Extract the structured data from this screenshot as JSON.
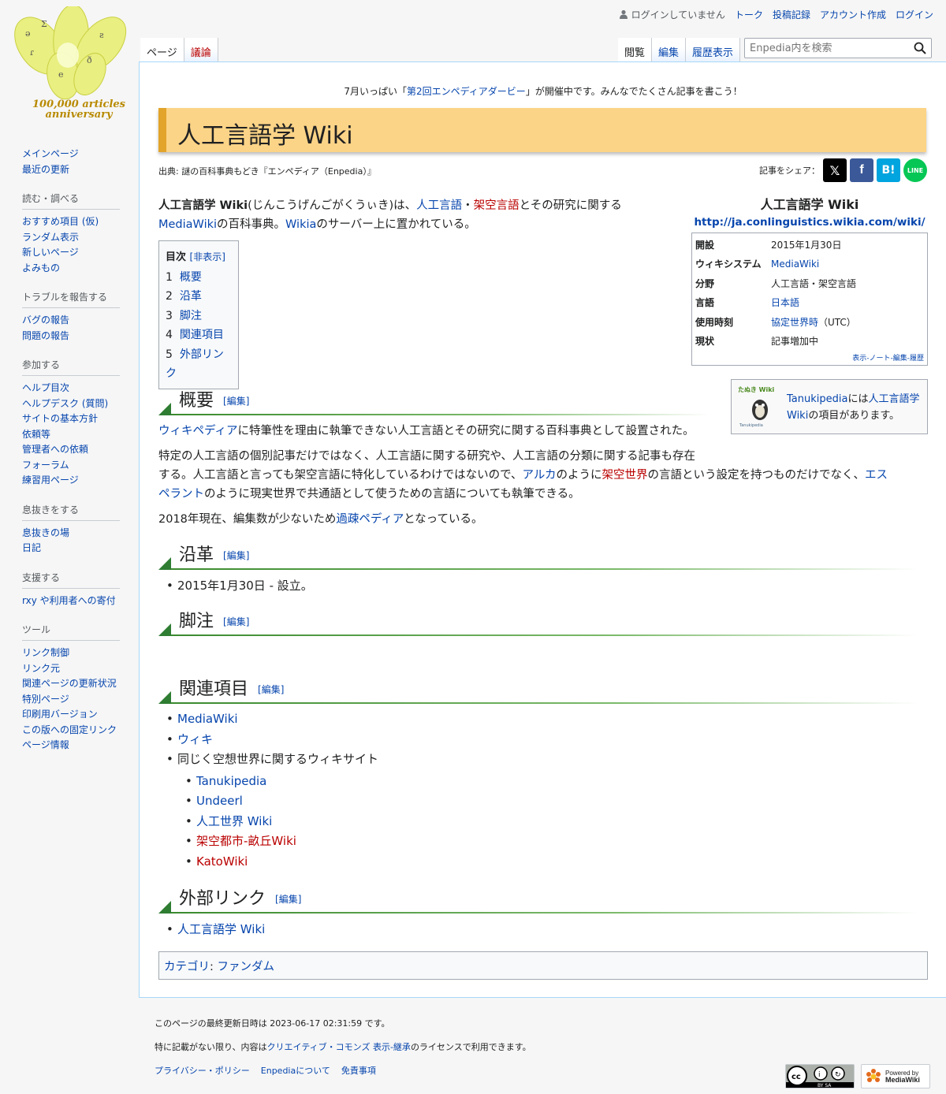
{
  "logo": {
    "text_line1": "100,000 articles",
    "text_line2": "anniversary"
  },
  "personal": {
    "status": "ログインしていません",
    "links": [
      "トーク",
      "投稿記録",
      "アカウント作成",
      "ログイン"
    ]
  },
  "tabs": {
    "left": [
      {
        "label": "ページ"
      },
      {
        "label": "議論"
      }
    ],
    "right": [
      {
        "label": "閲覧"
      },
      {
        "label": "編集"
      },
      {
        "label": "履歴表示"
      }
    ]
  },
  "search": {
    "placeholder": "Enpedia内を検索"
  },
  "sidebar": {
    "main": [
      "メインページ",
      "最近の更新"
    ],
    "groups": [
      {
        "heading": "読む・調べる",
        "items": [
          "おすすめ項目 (仮)",
          "ランダム表示",
          "新しいページ",
          "よみもの"
        ]
      },
      {
        "heading": "トラブルを報告する",
        "items": [
          "バグの報告",
          "問題の報告"
        ]
      },
      {
        "heading": "参加する",
        "items": [
          "ヘルプ目次",
          "ヘルプデスク (質問)",
          "サイトの基本方針",
          "依頼等",
          "管理者への依頼",
          "フォーラム",
          "練習用ページ"
        ]
      },
      {
        "heading": "息抜きをする",
        "items": [
          "息抜きの場",
          "日記"
        ]
      },
      {
        "heading": "支援する",
        "items": [
          "rxy や利用者への寄付"
        ]
      },
      {
        "heading": "ツール",
        "items": [
          "リンク制御",
          "リンク元",
          "関連ページの更新状況",
          "特別ページ",
          "印刷用バージョン",
          "この版への固定リンク",
          "ページ情報"
        ]
      }
    ]
  },
  "notice": {
    "before": "7月いっぱい「",
    "link": "第2回エンペディアダービー",
    "after": "」が開催中です。みんなでたくさん記事を書こう！"
  },
  "page": {
    "title": "人工言語学 Wiki",
    "source": "出典: 謎の百科事典もどき『エンペディア（Enpedia）』",
    "share_label": "記事をシェア："
  },
  "lead": {
    "bold": "人工言語学 Wiki",
    "t1": "(じんこうげんごがくうぃき)は、",
    "l1": "人工言語",
    "t2": "・",
    "l2": "架空言語",
    "t3": "とその研究に関する",
    "l3": "MediaWiki",
    "t4": "の百科事典。",
    "l4": "Wikia",
    "t5": "のサーバー上に置かれている。"
  },
  "toc": {
    "title": "目次",
    "toggle": "[非表示]",
    "items": [
      {
        "num": "1",
        "label": "概要"
      },
      {
        "num": "2",
        "label": "沿革"
      },
      {
        "num": "3",
        "label": "脚注"
      },
      {
        "num": "4",
        "label": "関連項目"
      },
      {
        "num": "5",
        "label": "外部リンク"
      }
    ]
  },
  "infobox": {
    "title": "人工言語学 Wiki",
    "url": "http://ja.conlinguistics.wikia.com/wiki/",
    "rows": [
      {
        "key": "開設",
        "value": "2015年1月30日"
      },
      {
        "key": "ウィキシステム",
        "value": "MediaWiki"
      },
      {
        "key": "分野",
        "value": "人工言語・架空言語"
      },
      {
        "key": "言語",
        "value": "日本語"
      },
      {
        "key": "使用時刻",
        "value": "協定世界時",
        "suffix": "（UTC）"
      },
      {
        "key": "現状",
        "value": "記事増加中"
      }
    ],
    "footer": "表示-ノート-編集-履歴"
  },
  "tanuki": {
    "logo": "たぬき Wiki",
    "logo_sub": "Tanukipedia",
    "t1": "Tanukipedia",
    "t2": "には",
    "link": "人工言語学 Wiki",
    "t3": "の項目があります。"
  },
  "sections": {
    "edit": "[編集]",
    "overview": {
      "heading": "概要",
      "p1_link": "ウィキペディア",
      "p1_text": "に特筆性を理由に執筆できない人工言語とその研究に関する百科事典として設置された。",
      "p2_a": "特定の人工言語の個別記事だけではなく、人工言語に関する研究や、人工言語の分類に関する記事も存在",
      "p2_b": "する。人工言語と言っても架空言語に特化しているわけではないので、",
      "p2_l1": "アルカ",
      "p2_c": "のように",
      "p2_l2": "架空世界",
      "p2_d": "の言語という設定を持つものだけでなく、",
      "p2_l3a": "エス",
      "p2_l3b": "ペラント",
      "p2_e": "のように現実世界で共通語として使うための言語についても執筆できる。",
      "p3_a": "2018年現在、編集数が少ないため",
      "p3_link": "過疎ペディア",
      "p3_b": "となっている。"
    },
    "history": {
      "heading": "沿革",
      "items": [
        "2015年1月30日 - 設立。"
      ]
    },
    "notes": {
      "heading": "脚注"
    },
    "related": {
      "heading": "関連項目",
      "items": [
        "MediaWiki",
        "ウィキ"
      ],
      "group": "同じく空想世界に関するウィキサイト",
      "sub": [
        {
          "label": "Tanukipedia",
          "red": false
        },
        {
          "label": "Undeerl",
          "red": false
        },
        {
          "label": "人工世界 Wiki",
          "red": false
        },
        {
          "label": "架空都市-畝丘Wiki",
          "red": true
        },
        {
          "label": "KatoWiki",
          "red": true
        }
      ]
    },
    "external": {
      "heading": "外部リンク",
      "items": [
        "人工言語学 Wiki"
      ]
    }
  },
  "category": {
    "label": "カテゴリ",
    "value": "ファンダム"
  },
  "footer": {
    "updated": "このページの最終更新日時は 2023-06-17 02:31:59 です。",
    "license_a": "特に記載がない限り、内容は",
    "license_link": "クリエイティブ・コモンズ 表示-継承",
    "license_b": "のライセンスで利用できます。",
    "links": [
      "プライバシー・ポリシー",
      "Enpediaについて",
      "免責事項"
    ],
    "powered_1": "Powered by",
    "powered_2": "MediaWiki"
  },
  "colors": {
    "link": "#0645ad",
    "redlink": "#ba0000",
    "title_bg": "#fcd487",
    "title_border": "#e2a42b",
    "heading_green": "#3a8a2e"
  }
}
